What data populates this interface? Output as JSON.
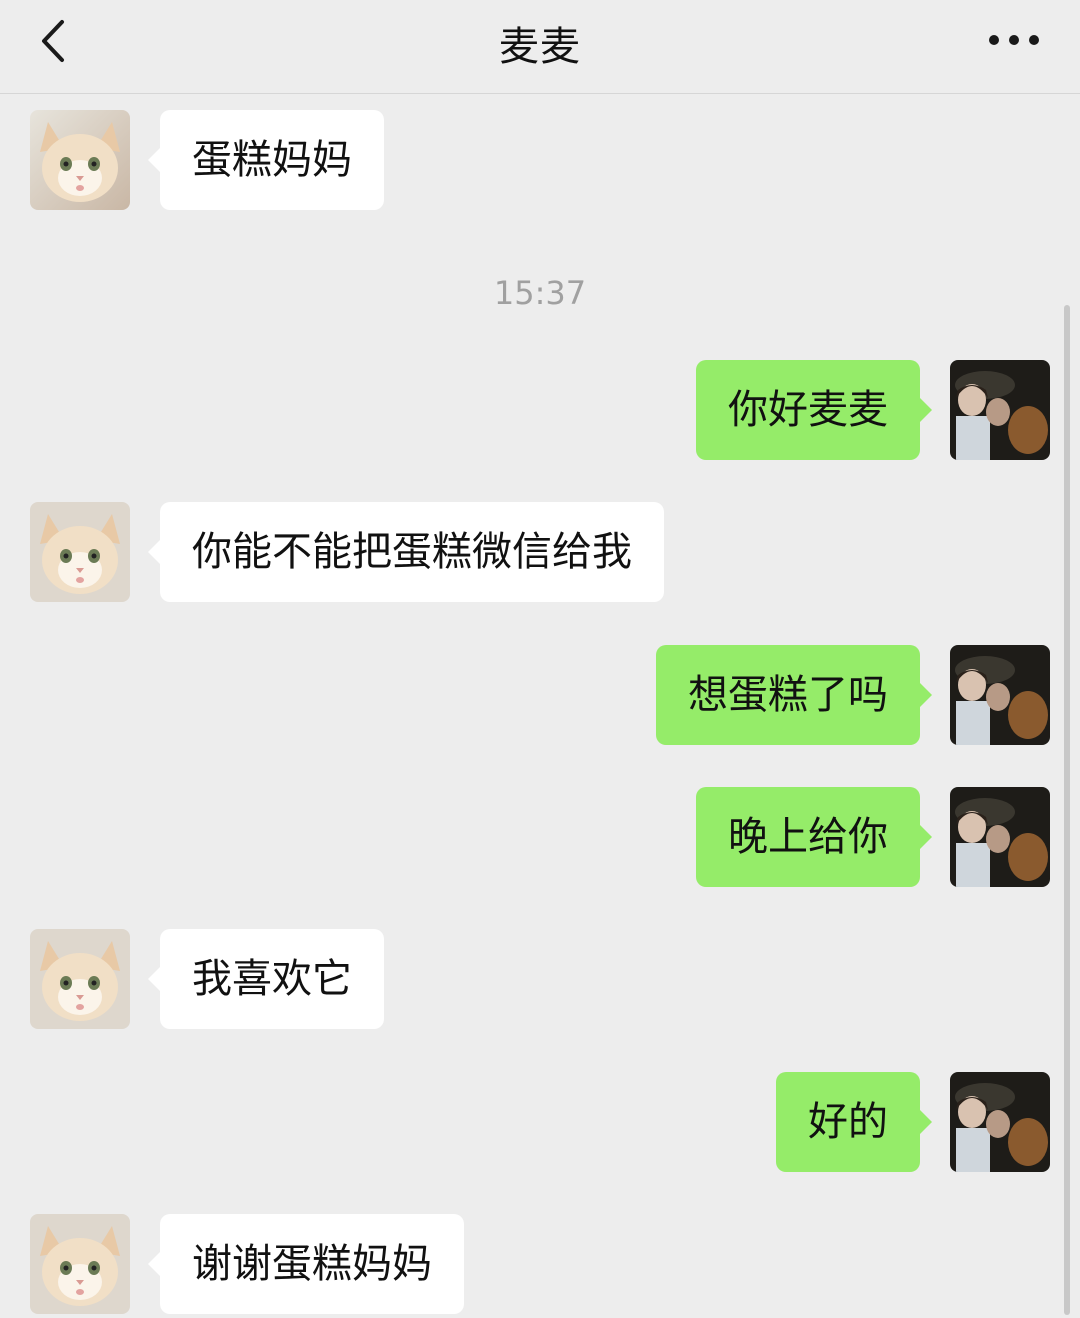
{
  "header": {
    "title": "麦麦",
    "back_icon": "chevron-left-icon",
    "more_icon": "more-dots-icon"
  },
  "timestamp": "15:37",
  "colors": {
    "background": "#ededed",
    "incoming_bubble": "#ffffff",
    "outgoing_bubble": "#95ec69",
    "timestamp_text": "#a0a0a0"
  },
  "messages": [
    {
      "side": "incoming",
      "avatar": "cat-avatar",
      "text": "蛋糕妈妈"
    },
    {
      "side": "outgoing",
      "avatar": "girl-avatar",
      "text": "你好麦麦"
    },
    {
      "side": "incoming",
      "avatar": "cat-avatar",
      "text": "你能不能把蛋糕微信给我"
    },
    {
      "side": "outgoing",
      "avatar": "girl-avatar",
      "text": "想蛋糕了吗"
    },
    {
      "side": "outgoing",
      "avatar": "girl-avatar",
      "text": "晚上给你"
    },
    {
      "side": "incoming",
      "avatar": "cat-avatar",
      "text": "我喜欢它"
    },
    {
      "side": "outgoing",
      "avatar": "girl-avatar",
      "text": "好的"
    },
    {
      "side": "incoming",
      "avatar": "cat-avatar",
      "text": "谢谢蛋糕妈妈"
    }
  ]
}
